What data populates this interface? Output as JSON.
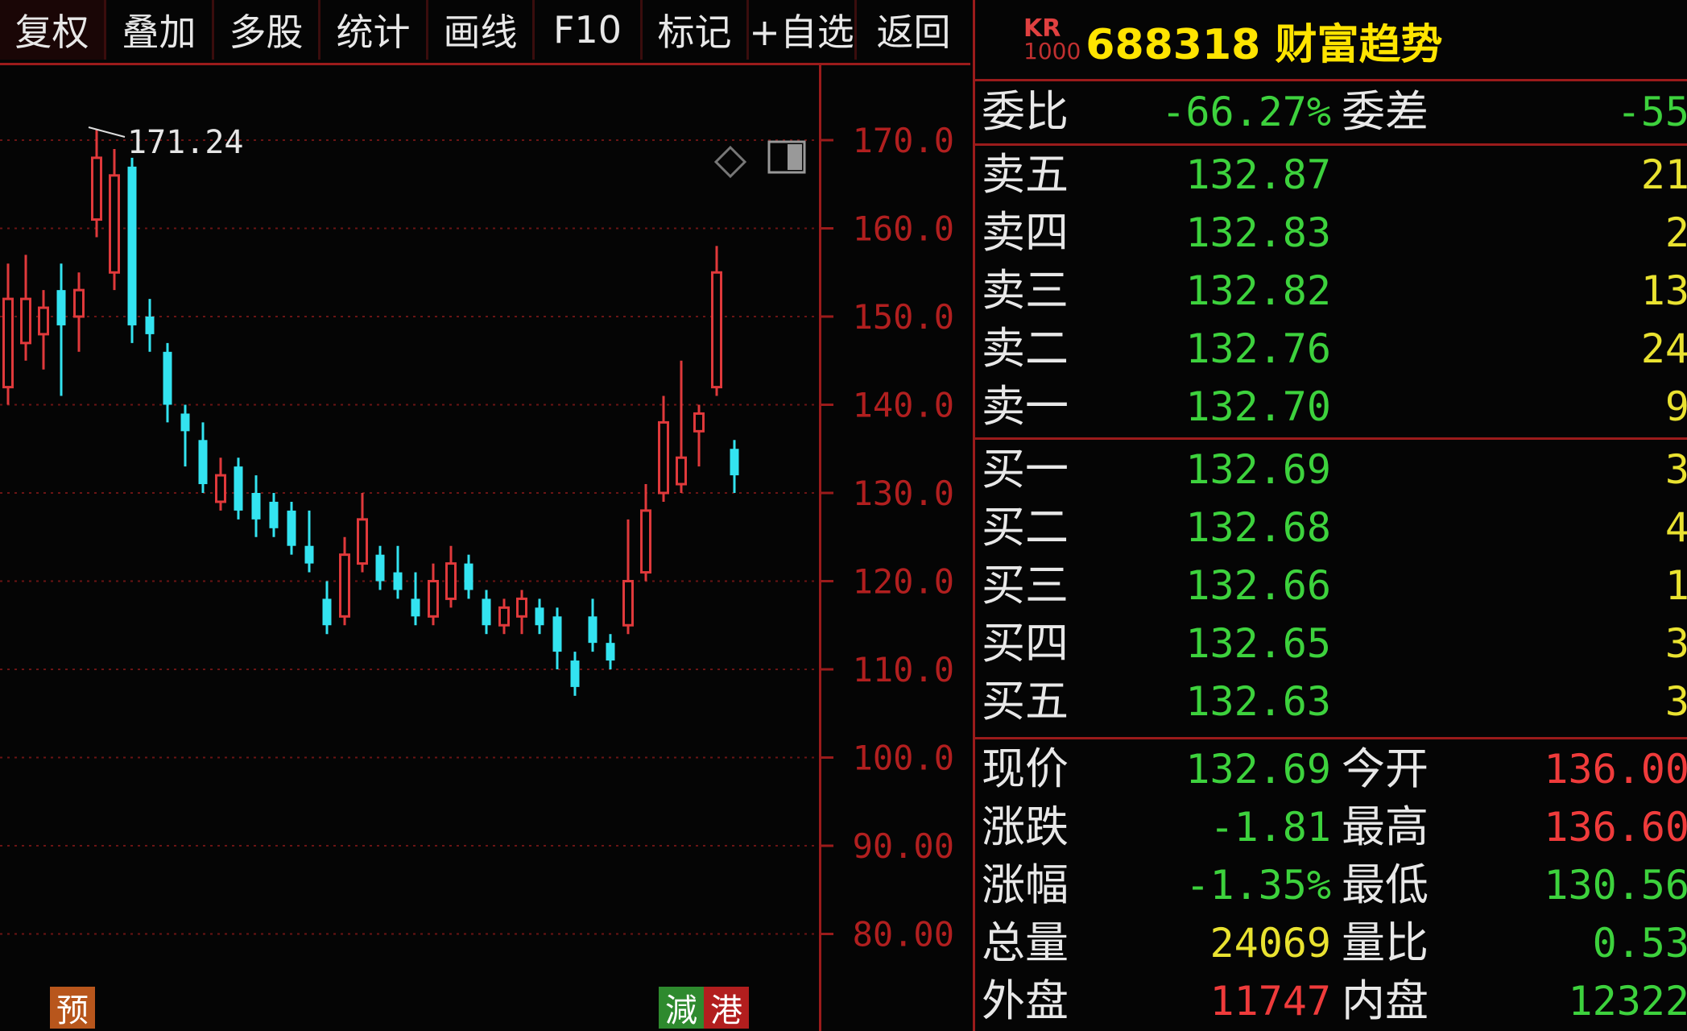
{
  "toolbar": {
    "items": [
      "复权",
      "叠加",
      "多股",
      "统计",
      "画线",
      "F10",
      "标记",
      "+自选",
      "返回"
    ]
  },
  "chart": {
    "peak_label": "171.24",
    "y_ticks": [
      "170.0",
      "160.0",
      "150.0",
      "140.0",
      "130.0",
      "120.0",
      "110.0",
      "100.0",
      "90.00",
      "80.00"
    ],
    "badges": {
      "yu": "预",
      "jian": "減",
      "gang": "港"
    },
    "colors": {
      "up": "#e0393b",
      "down": "#33e3f0",
      "grid": "#6b1414",
      "axis": "#9b1b1b"
    }
  },
  "chart_data": {
    "type": "candlestick",
    "y_ticks": [
      170,
      160,
      150,
      140,
      130,
      120,
      110,
      100,
      90,
      80
    ],
    "candles": [
      {
        "o": 142,
        "c": 152,
        "h": 156,
        "l": 140
      },
      {
        "o": 147,
        "c": 152,
        "h": 157,
        "l": 145
      },
      {
        "o": 148,
        "c": 151,
        "h": 153,
        "l": 144
      },
      {
        "o": 153,
        "c": 149,
        "h": 156,
        "l": 141
      },
      {
        "o": 150,
        "c": 153,
        "h": 155,
        "l": 146
      },
      {
        "o": 161,
        "c": 168,
        "h": 171.24,
        "l": 159
      },
      {
        "o": 155,
        "c": 166,
        "h": 169,
        "l": 153
      },
      {
        "o": 167,
        "c": 149,
        "h": 168,
        "l": 147
      },
      {
        "o": 150,
        "c": 148,
        "h": 152,
        "l": 146
      },
      {
        "o": 146,
        "c": 140,
        "h": 147,
        "l": 138
      },
      {
        "o": 139,
        "c": 137,
        "h": 140,
        "l": 133
      },
      {
        "o": 136,
        "c": 131,
        "h": 138,
        "l": 130
      },
      {
        "o": 129,
        "c": 132,
        "h": 134,
        "l": 128
      },
      {
        "o": 133,
        "c": 128,
        "h": 134,
        "l": 127
      },
      {
        "o": 130,
        "c": 127,
        "h": 132,
        "l": 125
      },
      {
        "o": 129,
        "c": 126,
        "h": 130,
        "l": 125
      },
      {
        "o": 128,
        "c": 124,
        "h": 129,
        "l": 123
      },
      {
        "o": 124,
        "c": 122,
        "h": 128,
        "l": 121
      },
      {
        "o": 118,
        "c": 115,
        "h": 120,
        "l": 114
      },
      {
        "o": 116,
        "c": 123,
        "h": 125,
        "l": 115
      },
      {
        "o": 122,
        "c": 127,
        "h": 130,
        "l": 121
      },
      {
        "o": 123,
        "c": 120,
        "h": 124,
        "l": 119
      },
      {
        "o": 121,
        "c": 119,
        "h": 124,
        "l": 118
      },
      {
        "o": 118,
        "c": 116,
        "h": 121,
        "l": 115
      },
      {
        "o": 116,
        "c": 120,
        "h": 122,
        "l": 115
      },
      {
        "o": 118,
        "c": 122,
        "h": 124,
        "l": 117
      },
      {
        "o": 122,
        "c": 119,
        "h": 123,
        "l": 118
      },
      {
        "o": 118,
        "c": 115,
        "h": 119,
        "l": 114
      },
      {
        "o": 115,
        "c": 117,
        "h": 118,
        "l": 114
      },
      {
        "o": 116,
        "c": 118,
        "h": 119,
        "l": 114
      },
      {
        "o": 117,
        "c": 115,
        "h": 118,
        "l": 114
      },
      {
        "o": 116,
        "c": 112,
        "h": 117,
        "l": 110
      },
      {
        "o": 111,
        "c": 108,
        "h": 112,
        "l": 107
      },
      {
        "o": 116,
        "c": 113,
        "h": 118,
        "l": 112
      },
      {
        "o": 113,
        "c": 111,
        "h": 114,
        "l": 110
      },
      {
        "o": 115,
        "c": 120,
        "h": 127,
        "l": 114
      },
      {
        "o": 121,
        "c": 128,
        "h": 131,
        "l": 120
      },
      {
        "o": 130,
        "c": 138,
        "h": 141,
        "l": 129
      },
      {
        "o": 131,
        "c": 134,
        "h": 145,
        "l": 130
      },
      {
        "o": 137,
        "c": 139,
        "h": 140,
        "l": 133
      },
      {
        "o": 142,
        "c": 155,
        "h": 158,
        "l": 141
      },
      {
        "o": 135,
        "c": 132,
        "h": 136,
        "l": 130
      }
    ]
  },
  "panel": {
    "kr_top": "KR",
    "kr_bottom": "1000",
    "title": "688318 财富趋势",
    "weibi_label": "委比",
    "weibi_value": "-66.27%",
    "weicha_label": "委差",
    "weicha_value": "-55",
    "asks": [
      {
        "label": "卖五",
        "price": "132.87",
        "vol": "21"
      },
      {
        "label": "卖四",
        "price": "132.83",
        "vol": "2"
      },
      {
        "label": "卖三",
        "price": "132.82",
        "vol": "13"
      },
      {
        "label": "卖二",
        "price": "132.76",
        "vol": "24"
      },
      {
        "label": "卖一",
        "price": "132.70",
        "vol": "9"
      }
    ],
    "bids": [
      {
        "label": "买一",
        "price": "132.69",
        "vol": "3"
      },
      {
        "label": "买二",
        "price": "132.68",
        "vol": "4"
      },
      {
        "label": "买三",
        "price": "132.66",
        "vol": "1"
      },
      {
        "label": "买四",
        "price": "132.65",
        "vol": "3"
      },
      {
        "label": "买五",
        "price": "132.63",
        "vol": "3"
      }
    ],
    "stats": [
      {
        "l1": "现价",
        "v1": "132.69",
        "c1": "green",
        "l2": "今开",
        "v2": "136.00",
        "c2": "red"
      },
      {
        "l1": "涨跌",
        "v1": "-1.81",
        "c1": "green",
        "l2": "最高",
        "v2": "136.60",
        "c2": "red"
      },
      {
        "l1": "涨幅",
        "v1": "-1.35%",
        "c1": "green",
        "l2": "最低",
        "v2": "130.56",
        "c2": "green"
      },
      {
        "l1": "总量",
        "v1": "24069",
        "c1": "yellow",
        "l2": "量比",
        "v2": "0.53",
        "c2": "green"
      },
      {
        "l1": "外盘",
        "v1": "11747",
        "c1": "red",
        "l2": "内盘",
        "v2": "12322",
        "c2": "green"
      }
    ]
  }
}
